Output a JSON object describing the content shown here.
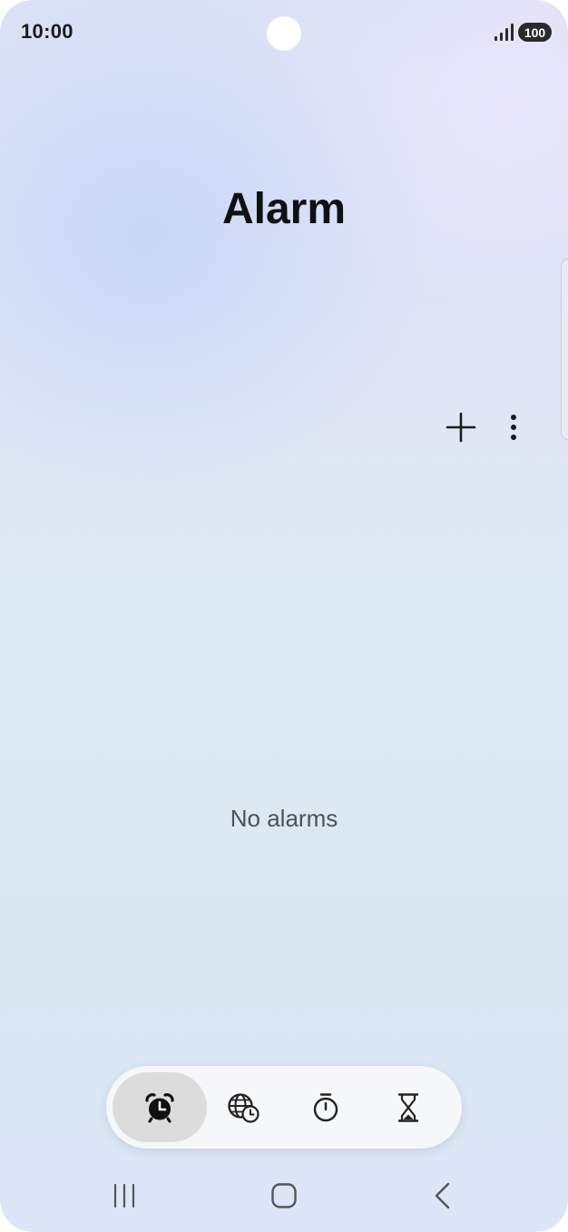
{
  "status_bar": {
    "time": "10:00",
    "battery": "100",
    "signal_icon": "signal-bars-icon"
  },
  "header": {
    "title": "Alarm"
  },
  "toolbar": {
    "add_icon": "plus-icon",
    "more_icon": "more-vertical-icon"
  },
  "main": {
    "empty_message": "No alarms"
  },
  "tabs": [
    {
      "icon": "alarm-clock-icon",
      "active": true
    },
    {
      "icon": "world-clock-icon",
      "active": false
    },
    {
      "icon": "stopwatch-icon",
      "active": false
    },
    {
      "icon": "hourglass-timer-icon",
      "active": false
    }
  ],
  "navigation": {
    "recents_icon": "recents-icon",
    "home_icon": "home-icon",
    "back_icon": "back-icon"
  }
}
